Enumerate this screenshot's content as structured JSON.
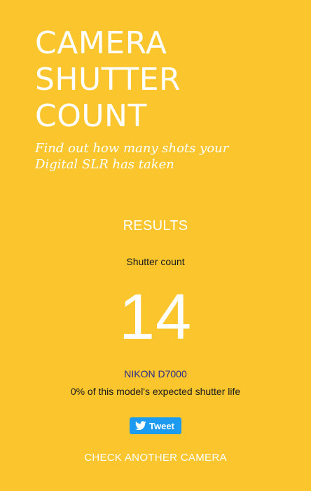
{
  "header": {
    "title_lines": [
      "CAMERA",
      "SHUTTER",
      "COUNT"
    ],
    "subtitle": "Find out how many shots your Digital SLR has taken"
  },
  "results": {
    "heading": "RESULTS",
    "count_label": "Shutter count",
    "count_value": "14",
    "model": "NIKON D7000",
    "life_text": "0% of this model's expected shutter life"
  },
  "actions": {
    "tweet_label": "Tweet",
    "tweet_icon": "twitter-bird-icon",
    "check_another_label": "CHECK ANOTHER CAMERA"
  },
  "colors": {
    "background": "#fbc52e",
    "text_light": "#ffffff",
    "text_dark": "#1a1a1a",
    "link": "#2a2a8a",
    "tweet_button": "#1d9bf0"
  }
}
